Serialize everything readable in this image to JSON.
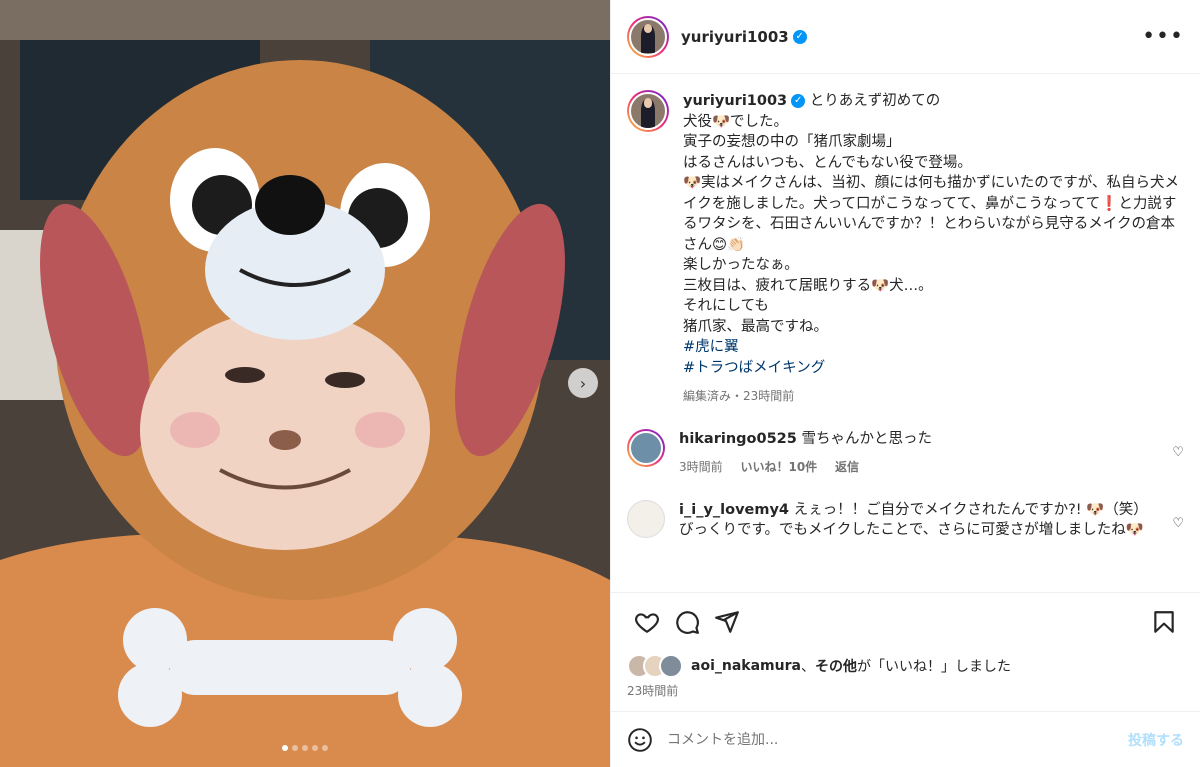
{
  "post": {
    "username": "yuriyuri1003",
    "more_label": "•••"
  },
  "caption": {
    "username": "yuriyuri1003",
    "lines": [
      "とりあえず初めての",
      "犬役🐶でした。",
      "寅子の妄想の中の「猪爪家劇場」",
      "はるさんはいつも、とんでもない役で登場。",
      "🐶実はメイクさんは、当初、顔には何も描かずにいたのですが、私自ら犬メイクを施しました。犬って口がこうなってて、鼻がこうなってて❗️と力説するワタシを、石田さんいいんですか？！とわらいながら見守るメイクの倉本さん😊👏🏻",
      "楽しかったなぁ。",
      "三枚目は、疲れて居眠りする🐶犬…。",
      "それにしても",
      "猪爪家、最高ですね。"
    ],
    "hashtags": [
      "#虎に翼",
      "#トラつばメイキング"
    ],
    "meta": "編集済み・23時間前"
  },
  "comments": [
    {
      "username": "hikaringo0525",
      "text": "雪ちゃんかと思った",
      "time": "3時間前",
      "likes": "いいね！10件",
      "reply": "返信"
    },
    {
      "username": "i_i_y_lovemy4",
      "text": "えぇっ！！ご自分でメイクされたんですか?! 🐶（笑）びっくりです。でもメイクしたことで、さらに可愛さが増しましたね🐶"
    }
  ],
  "likes_line": {
    "user": "aoi_nakamura",
    "sep": "、",
    "others": "その他",
    "suffix": "が「いいね！」しました"
  },
  "post_time": "23時間前",
  "comment_box": {
    "placeholder": "コメントを追加...",
    "post_label": "投稿する"
  },
  "carousel": {
    "count": 5,
    "active": 0
  },
  "colors": {
    "link": "#00376b",
    "verified": "#0095f6",
    "post_disabled": "#b2dffc",
    "meta": "#737373"
  }
}
